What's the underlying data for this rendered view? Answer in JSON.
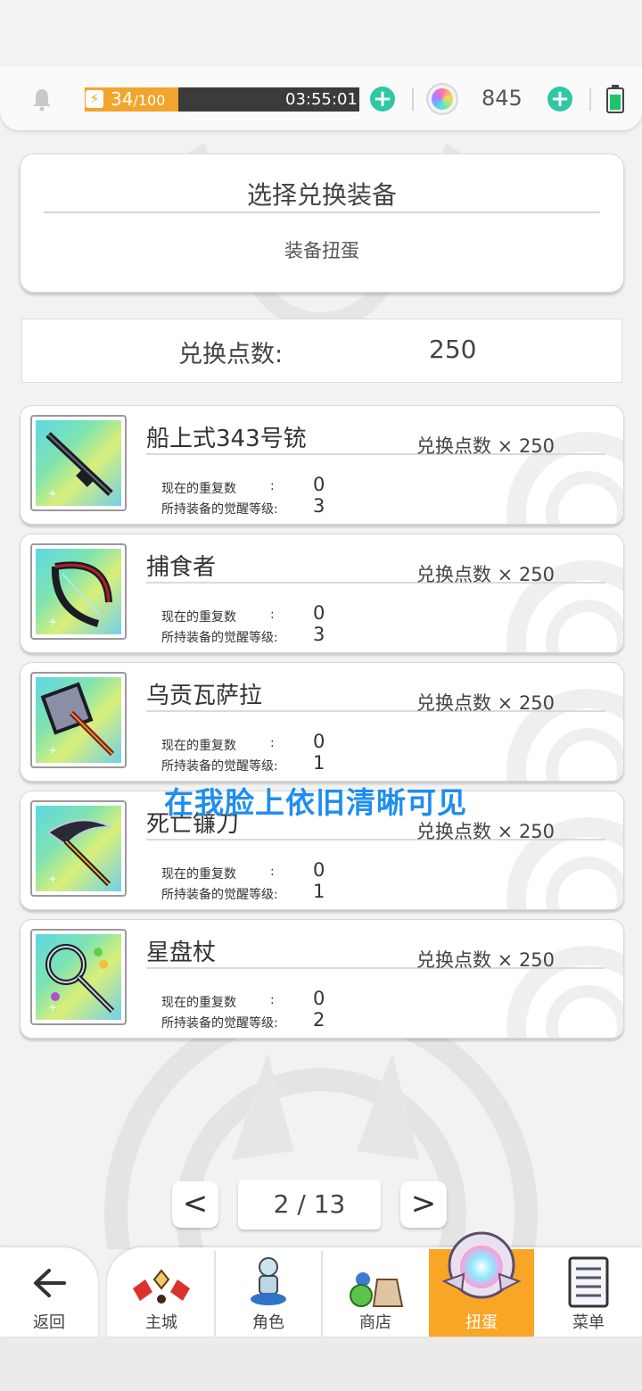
{
  "status": {
    "stamina_current": "34",
    "stamina_max": "/100",
    "stamina_fraction": 0.34,
    "timer": "03:55:01",
    "gem_count": "845"
  },
  "header": {
    "title": "选择兑换装备",
    "subtitle": "装备扭蛋"
  },
  "points": {
    "label": "兑换点数:",
    "value": "250"
  },
  "stat_labels": {
    "repeat": "现在的重复数",
    "awaken": "所持装备的觉醒等级:",
    "colon": ":"
  },
  "items": [
    {
      "name": "船上式343号铳",
      "cost": "兑换点数 × 250",
      "repeat": "0",
      "awaken": "3",
      "icon": "rifle-icon"
    },
    {
      "name": "捕食者",
      "cost": "兑换点数 × 250",
      "repeat": "0",
      "awaken": "3",
      "icon": "bow-icon"
    },
    {
      "name": "乌贡瓦萨拉",
      "cost": "兑换点数 × 250",
      "repeat": "0",
      "awaken": "1",
      "icon": "axe-icon"
    },
    {
      "name": "死亡镰刀",
      "cost": "兑换点数 × 250",
      "repeat": "0",
      "awaken": "1",
      "icon": "scythe-icon"
    },
    {
      "name": "星盘杖",
      "cost": "兑换点数 × 250",
      "repeat": "0",
      "awaken": "2",
      "icon": "staff-icon"
    }
  ],
  "watermark": "在我脸上依旧清晰可见",
  "pager": {
    "label": "2 / 13",
    "prev": "<",
    "next": ">"
  },
  "nav": {
    "back": "返回",
    "main_city": "主城",
    "character": "角色",
    "shop": "商店",
    "gacha": "扭蛋",
    "menu": "菜单"
  },
  "colors": {
    "accent": "#f9a526",
    "plus": "#2fc7a4",
    "watermark": "#1e8ef0"
  }
}
